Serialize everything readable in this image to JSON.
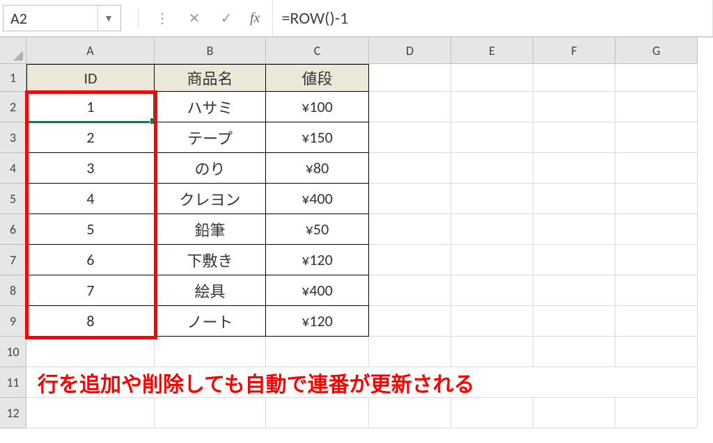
{
  "namebox": {
    "value": "A2"
  },
  "formula": {
    "value": "=ROW()-1"
  },
  "columns": [
    "A",
    "B",
    "C",
    "D",
    "E",
    "F",
    "G"
  ],
  "row_numbers": [
    1,
    2,
    3,
    4,
    5,
    6,
    7,
    8,
    9,
    10,
    11,
    12
  ],
  "table": {
    "headers": {
      "id": "ID",
      "name": "商品名",
      "price": "値段"
    },
    "rows": [
      {
        "id": "1",
        "name": "ハサミ",
        "price": "¥100"
      },
      {
        "id": "2",
        "name": "テープ",
        "price": "¥150"
      },
      {
        "id": "3",
        "name": "のり",
        "price": "¥80"
      },
      {
        "id": "4",
        "name": "クレヨン",
        "price": "¥400"
      },
      {
        "id": "5",
        "name": "鉛筆",
        "price": "¥50"
      },
      {
        "id": "6",
        "name": "下敷き",
        "price": "¥120"
      },
      {
        "id": "7",
        "name": "絵具",
        "price": "¥400"
      },
      {
        "id": "8",
        "name": "ノート",
        "price": "¥120"
      }
    ]
  },
  "annotation": "行を追加や削除しても自動で連番が更新される",
  "colors": {
    "accent_green": "#217346",
    "highlight_red": "#ff0000",
    "header_beige": "#ece8d9"
  }
}
